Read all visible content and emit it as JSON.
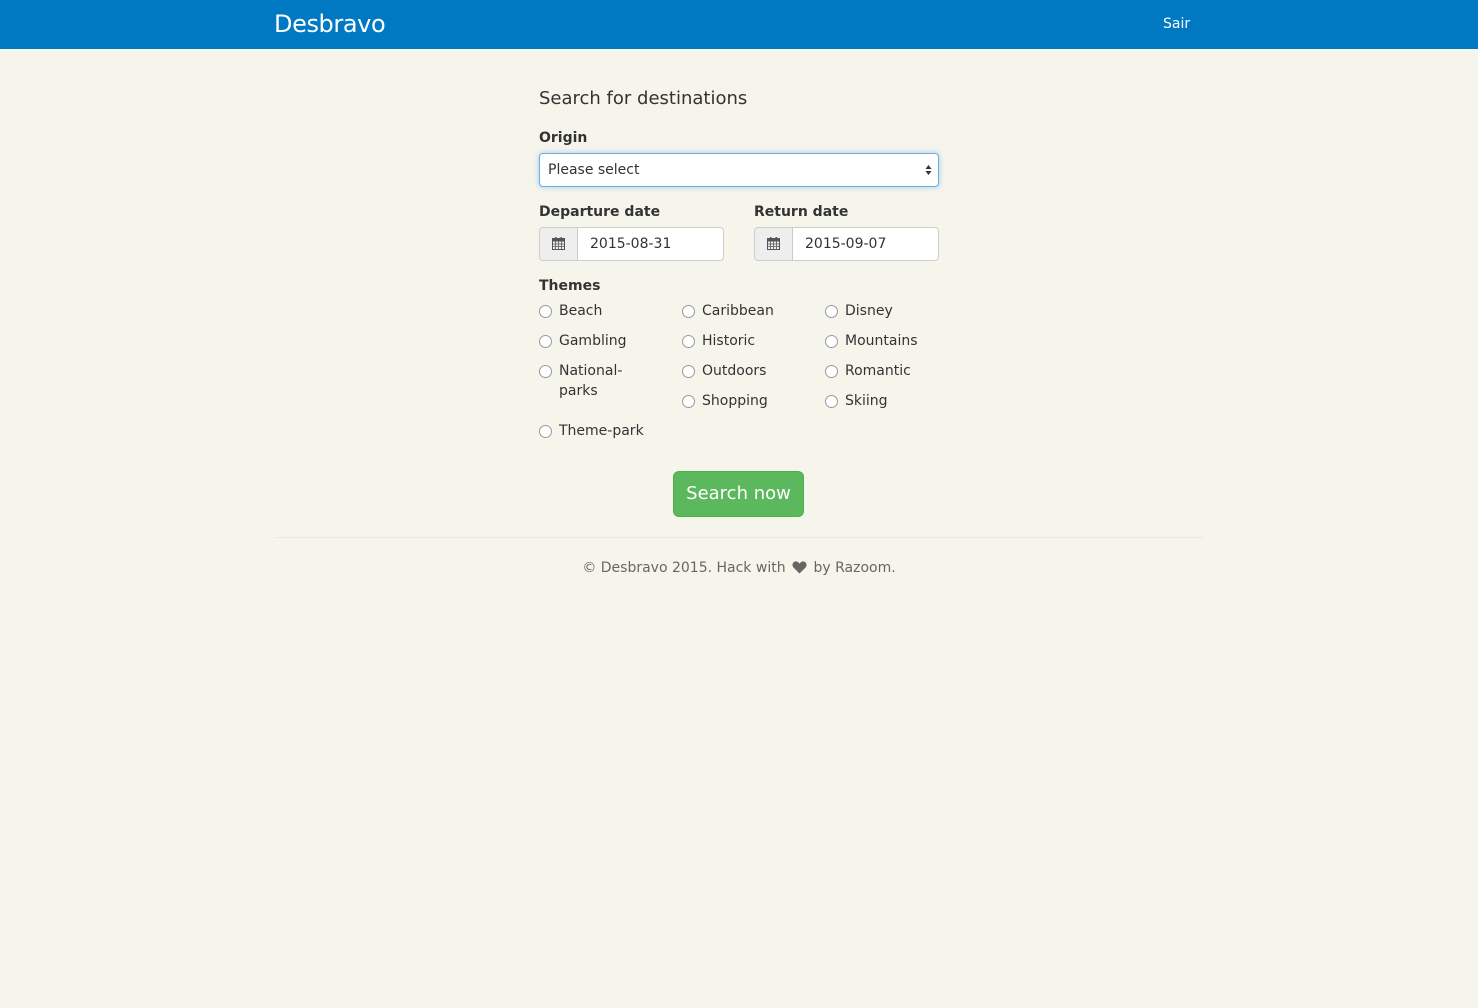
{
  "navbar": {
    "brand": "Desbravo",
    "logout_label": "Sair",
    "bg_color": "#0079c2"
  },
  "form": {
    "title": "Search for destinations",
    "origin": {
      "label": "Origin",
      "selected": "Please select"
    },
    "departure": {
      "label": "Departure date",
      "value": "2015-08-31",
      "icon": "calendar-icon"
    },
    "return": {
      "label": "Return date",
      "value": "2015-09-07",
      "icon": "calendar-icon"
    },
    "themes": {
      "label": "Themes",
      "options": [
        "Beach",
        "Caribbean",
        "Disney",
        "Gambling",
        "Historic",
        "Mountains",
        "National-parks",
        "Outdoors",
        "Romantic",
        "Shopping",
        "Skiing",
        "Theme-park"
      ]
    },
    "submit_label": "Search now",
    "submit_color": "#5cb85c"
  },
  "footer": {
    "prefix": "© Desbravo 2015. Hack with",
    "icon": "heart-icon",
    "suffix": "by Razoom."
  }
}
